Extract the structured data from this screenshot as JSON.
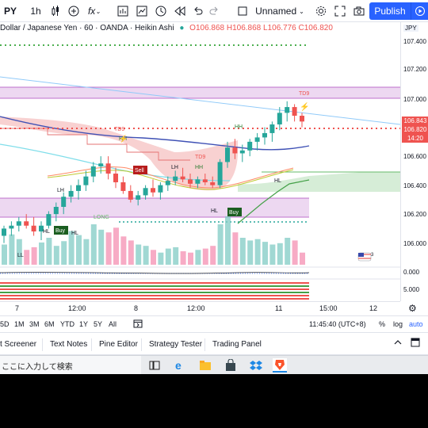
{
  "toolbar": {
    "symbol": "PY",
    "interval": "1h",
    "fx_label": "fx",
    "layout_name": "Unnamed",
    "publish_label": "Publish"
  },
  "legend": {
    "title": "Dollar / Japanese Yen · 60 · OANDA · Heikin Ashi",
    "ohlc": "O106.868 H106.868 L106.776 C106.820"
  },
  "price_scale": {
    "currency": "JPY",
    "labels": [
      "107.400",
      "107.200",
      "107.000",
      "106.600",
      "106.400",
      "106.200",
      "106.000"
    ],
    "tags": [
      {
        "text": "106.843",
        "color": "#ef5350"
      },
      {
        "text": "106.820",
        "color": "#ef5350"
      },
      {
        "text": "14:20",
        "color": "#ef5350"
      }
    ],
    "osc_labels": [
      "0.000",
      "5.000"
    ]
  },
  "time_axis": {
    "labels": [
      "7",
      "12:00",
      "8",
      "12:00",
      "11",
      "15:00",
      "12"
    ]
  },
  "range_bar": {
    "ranges": [
      "5D",
      "1M",
      "3M",
      "6M",
      "YTD",
      "1Y",
      "5Y",
      "All"
    ],
    "clock": "11:45:40 (UTC+8)",
    "percent": "%",
    "log": "log",
    "auto": "auto"
  },
  "panel_tabs": {
    "tabs": [
      "t Screener",
      "Text Notes",
      "Pine Editor",
      "Strategy Tester",
      "Trading Panel"
    ]
  },
  "taskbar": {
    "search_text": "ここに入力して検索"
  },
  "chart_annotations": {
    "td9_top": "TD9",
    "td9_mid": "TD9",
    "td9_left": "TD9",
    "hh1": "HH",
    "hh2": "HH",
    "lh": "LH",
    "lh2": "LH",
    "hl1": "HL",
    "hl2": "HL",
    "hl3": "HL",
    "hl4": "HL",
    "ll": "LL",
    "sell": "Sell",
    "buy1": "Buy",
    "buy2": "Buy",
    "long": "LONG",
    "hh3": "HH",
    "marker": "3"
  },
  "chart_data": {
    "type": "candlestick",
    "title": "Dollar / Japanese Yen · 60 · OANDA · Heikin Ashi",
    "ylim": [
      105.85,
      107.45
    ],
    "yticks": [
      106.0,
      106.2,
      106.4,
      106.6,
      107.0,
      107.2,
      107.4
    ],
    "candles": [
      [
        106.05,
        106.12,
        106.0,
        106.1
      ],
      [
        106.1,
        106.15,
        106.05,
        106.12
      ],
      [
        106.12,
        106.18,
        106.08,
        106.15
      ],
      [
        106.15,
        106.2,
        106.1,
        106.12
      ],
      [
        106.12,
        106.18,
        106.05,
        106.08
      ],
      [
        106.08,
        106.15,
        106.02,
        106.12
      ],
      [
        106.12,
        106.22,
        106.1,
        106.2
      ],
      [
        106.2,
        106.28,
        106.15,
        106.25
      ],
      [
        106.25,
        106.35,
        106.2,
        106.32
      ],
      [
        106.32,
        106.4,
        106.28,
        106.36
      ],
      [
        106.36,
        106.44,
        106.3,
        106.4
      ],
      [
        106.4,
        106.5,
        106.36,
        106.46
      ],
      [
        106.46,
        106.56,
        106.42,
        106.53
      ],
      [
        106.53,
        106.6,
        106.48,
        106.55
      ],
      [
        106.55,
        106.6,
        106.44,
        106.48
      ],
      [
        106.48,
        106.52,
        106.38,
        106.42
      ],
      [
        106.42,
        106.46,
        106.34,
        106.36
      ],
      [
        106.36,
        106.4,
        106.28,
        106.3
      ],
      [
        106.3,
        106.36,
        106.26,
        106.33
      ],
      [
        106.33,
        106.4,
        106.3,
        106.38
      ],
      [
        106.38,
        106.44,
        106.32,
        106.35
      ],
      [
        106.35,
        106.42,
        106.3,
        106.4
      ],
      [
        106.4,
        106.46,
        106.36,
        106.43
      ],
      [
        106.43,
        106.5,
        106.4,
        106.46
      ],
      [
        106.46,
        106.52,
        106.42,
        106.44
      ],
      [
        106.44,
        106.48,
        106.38,
        106.41
      ],
      [
        106.41,
        106.46,
        106.38,
        106.44
      ],
      [
        106.44,
        106.48,
        106.4,
        106.42
      ],
      [
        106.42,
        106.46,
        106.38,
        106.4
      ],
      [
        106.4,
        106.58,
        106.38,
        106.56
      ],
      [
        106.56,
        106.7,
        106.52,
        106.66
      ],
      [
        106.66,
        106.72,
        106.58,
        106.62
      ],
      [
        106.62,
        106.68,
        106.56,
        106.64
      ],
      [
        106.64,
        106.72,
        106.6,
        106.7
      ],
      [
        106.7,
        106.76,
        106.64,
        106.73
      ],
      [
        106.73,
        106.8,
        106.68,
        106.76
      ],
      [
        106.76,
        106.84,
        106.7,
        106.82
      ],
      [
        106.82,
        106.94,
        106.78,
        106.9
      ],
      [
        106.9,
        106.98,
        106.84,
        106.94
      ],
      [
        106.94,
        106.96,
        106.84,
        106.88
      ],
      [
        106.88,
        106.9,
        106.8,
        106.84
      ]
    ],
    "volumes": [
      30,
      45,
      38,
      22,
      26,
      33,
      40,
      28,
      35,
      50,
      44,
      38,
      60,
      52,
      48,
      55,
      42,
      36,
      30,
      28,
      22,
      18,
      24,
      26,
      20,
      18,
      22,
      24,
      28,
      60,
      72,
      48,
      40,
      36,
      38,
      34,
      30,
      32,
      40,
      36,
      18
    ],
    "ma_blue": [
      106.8,
      106.78,
      106.76,
      106.74,
      106.72,
      106.7,
      106.69,
      106.68,
      106.67,
      106.66,
      106.66
    ],
    "ma_line_color": "#3f51b5",
    "dotted_price_line": 106.82
  }
}
